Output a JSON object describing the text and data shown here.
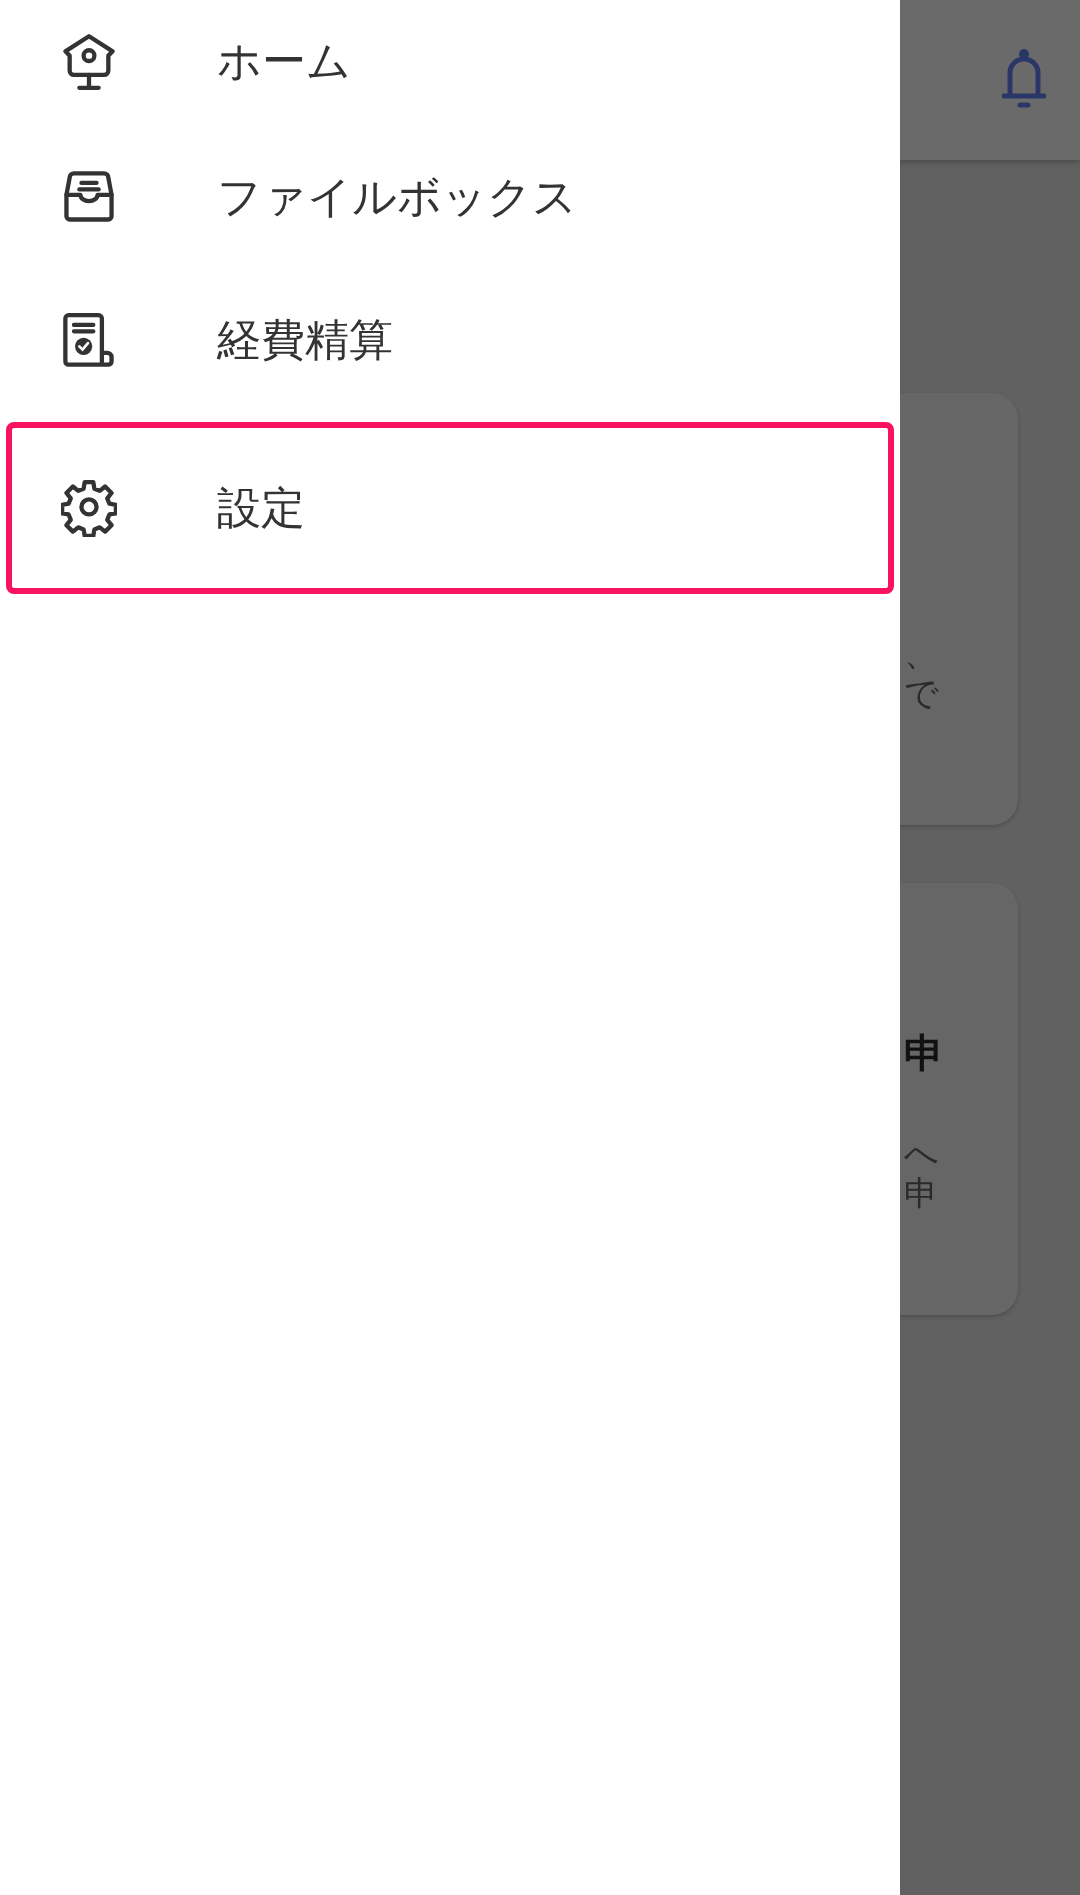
{
  "background": {
    "cards": [
      {
        "lines": [
          {
            "text": "、",
            "bold": false
          },
          {
            "text": "で",
            "bold": false
          }
        ]
      },
      {
        "lines": [
          {
            "text": "申",
            "bold": true
          },
          {
            "text": "へ",
            "bold": false
          },
          {
            "text": "申",
            "bold": false
          }
        ]
      }
    ]
  },
  "drawer": {
    "items": [
      {
        "label": "ホーム",
        "kind": "home",
        "selected": false
      },
      {
        "label": "ファイルボックス",
        "kind": "inbox",
        "selected": false
      },
      {
        "label": "経費精算",
        "kind": "receipt",
        "selected": false
      },
      {
        "label": "設定",
        "kind": "settings",
        "selected": true
      }
    ]
  }
}
